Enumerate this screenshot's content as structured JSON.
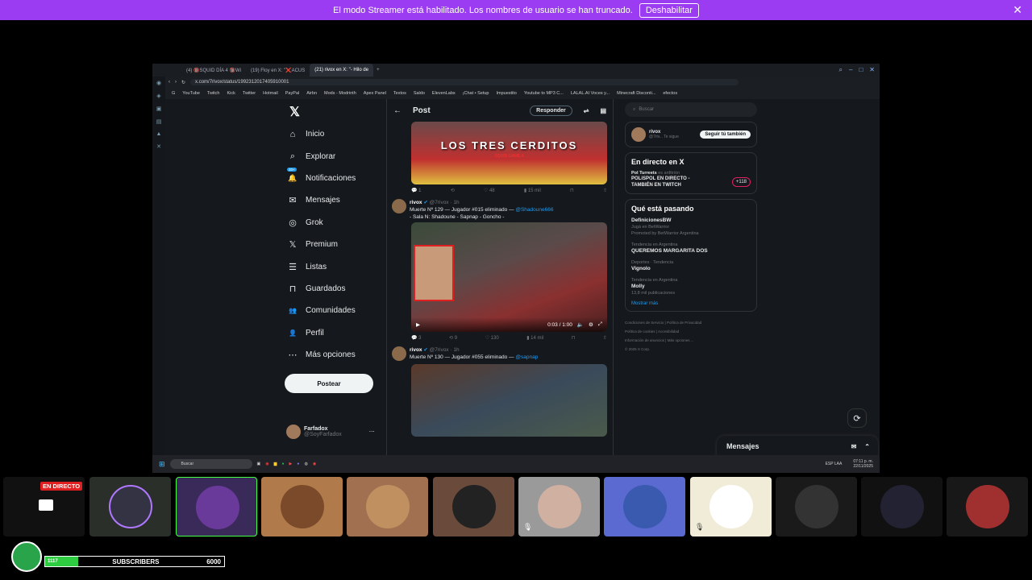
{
  "banner": {
    "text": "El modo Streamer está habilitado. Los nombres de usuario se han truncado.",
    "button": "Deshabilitar",
    "close": "✕"
  },
  "browser": {
    "tabs": [
      "(4) 🔞SQUID DÍA 4 🔞Wi",
      "(19) Floy en X: \"❌ACUS",
      "(21) rivox en X: \"- Hilo de"
    ],
    "url": "x.com/7rivox/status/1992312017405910001",
    "bookmarks": [
      "G",
      "YouTube",
      "Twitch",
      "Kick",
      "Twitter",
      "Hotmail",
      "PayPal",
      "Airbn",
      "Mods - Modrinth",
      "Apex Panel",
      "Textos",
      "Saldo",
      "ElevenLabs",
      "¡Chat • Setup",
      "Impuestito",
      "Youtube to MP3 C...",
      "LALAL.AI Voces y...",
      "Minecraft Disconti...",
      "efectos"
    ]
  },
  "nav": {
    "items": [
      {
        "icon": "⌂",
        "label": "Inicio"
      },
      {
        "icon": "⌕",
        "label": "Explorar"
      },
      {
        "icon": "🔔",
        "label": "Notificaciones",
        "badge": "20+"
      },
      {
        "icon": "✉",
        "label": "Mensajes"
      },
      {
        "icon": "◎",
        "label": "Grok"
      },
      {
        "icon": "𝕏",
        "label": "Premium"
      },
      {
        "icon": "☰",
        "label": "Listas"
      },
      {
        "icon": "⊓",
        "label": "Guardados"
      },
      {
        "icon": "👥",
        "label": "Comunidades"
      },
      {
        "icon": "👤",
        "label": "Perfil"
      },
      {
        "icon": "⋯",
        "label": "Más opciones"
      }
    ],
    "post_button": "Postear",
    "profile_name": "Farfadox",
    "profile_handle": "@SoyFarfadox"
  },
  "post": {
    "header": "Post",
    "reply_button": "Responder",
    "banner_text": "LOS TRES CERDITOS",
    "banner_sub": "SQUID GAME 4",
    "actions1": [
      "1",
      "",
      "48",
      "15 mil"
    ],
    "tweet1": {
      "name": "rivox",
      "handle": "@7rivox · 1h",
      "line1": "Muerte Nº 129 — Jugador #015 eliminado — ",
      "mention": "@Shadoune666",
      "line2": "- Sala N: Shadoune - Sapnap - Goncho -",
      "time": "0:03 / 1:00"
    },
    "actions2": [
      "3",
      "9",
      "130",
      "14 mil"
    ],
    "tweet2": {
      "name": "rivox",
      "handle": "@7rivox · 1h",
      "line1": "Muerte Nº 130 — Jugador #055 eliminado — ",
      "mention": "@sapnap"
    }
  },
  "right": {
    "search_placeholder": "Buscar",
    "who": {
      "name": "rivox",
      "handle": "@7riv... Te sigue",
      "button": "Seguir tú también"
    },
    "live": {
      "title": "En directo en X",
      "host": "Pol Turreets",
      "role": "es anfitrión",
      "text": "POLiSPOL EN DIRECTO - TAMBIÉN EN TWITCH",
      "count": "+118"
    },
    "trending": {
      "title": "Qué está pasando",
      "items": [
        {
          "meta": "",
          "name": "DefinicionesBW",
          "sub": "Jugá en BetWarrior",
          "extra": "Promoted by BetWarrior Argentina"
        },
        {
          "meta": "Tendencia en Argentina",
          "name": "QUEREMOS MARGARITA DOS",
          "sub": ""
        },
        {
          "meta": "Deportes · Tendencia",
          "name": "Vignolo",
          "sub": ""
        },
        {
          "meta": "Tendencia en Argentina",
          "name": "Molly",
          "sub": "13,8 mil publicaciones"
        }
      ],
      "more": "Mostrar más"
    },
    "footer": [
      "Condiciones de Servicio",
      "Política de Privacidad",
      "Política de cookies",
      "Accesibilidad",
      "Información de anuncios",
      "Más opciones ...",
      "© 2025 X Corp."
    ],
    "messages": "Mensajes"
  },
  "taskbar": {
    "search": "Buscar",
    "lang": "ESP LAA",
    "time": "07:11 p. m.",
    "date": "22/11/2025"
  },
  "stream": {
    "live_badge": "EN DIRECTO",
    "subs_label": "SUBSCRIBERS",
    "subs_current": "1117",
    "subs_goal": "6000",
    "subs_fraction": 0.186
  },
  "colors": {
    "banner": "#9b3cf3",
    "accent": "#1d9bf0",
    "live": "#e02020",
    "subs_bar": "#2ecc40"
  }
}
